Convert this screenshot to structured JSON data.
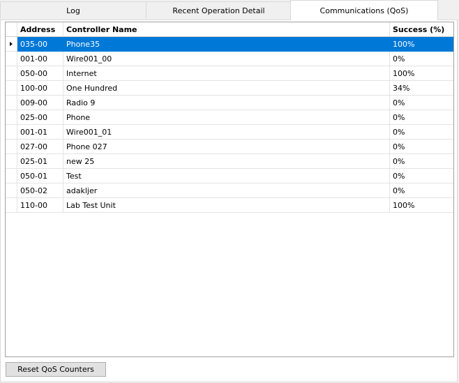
{
  "tabs": [
    {
      "label": "Log"
    },
    {
      "label": "Recent Operation Detail"
    },
    {
      "label": "Communications (QoS)"
    }
  ],
  "grid": {
    "columns": [
      "Address",
      "Controller Name",
      "Success (%)"
    ],
    "rows": [
      {
        "address": "035-00",
        "name": "Phone35",
        "success": "100%"
      },
      {
        "address": "001-00",
        "name": "Wire001_00",
        "success": "0%"
      },
      {
        "address": "050-00",
        "name": "Internet",
        "success": "100%"
      },
      {
        "address": "100-00",
        "name": "One Hundred",
        "success": "34%"
      },
      {
        "address": "009-00",
        "name": "Radio 9",
        "success": "0%"
      },
      {
        "address": "025-00",
        "name": "Phone",
        "success": "0%"
      },
      {
        "address": "001-01",
        "name": "Wire001_01",
        "success": "0%"
      },
      {
        "address": "027-00",
        "name": "Phone 027",
        "success": "0%"
      },
      {
        "address": "025-01",
        "name": "new 25",
        "success": "0%"
      },
      {
        "address": "050-01",
        "name": "Test",
        "success": "0%"
      },
      {
        "address": "050-02",
        "name": "adakljer",
        "success": "0%"
      },
      {
        "address": "110-00",
        "name": "Lab Test Unit",
        "success": "100%"
      }
    ]
  },
  "buttons": {
    "reset_label": "Reset QoS Counters"
  },
  "colors": {
    "selection": "#0078d7"
  }
}
